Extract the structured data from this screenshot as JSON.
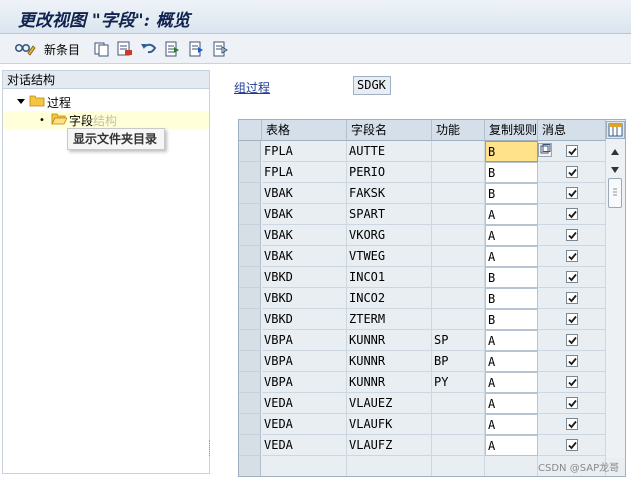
{
  "window": {
    "title": "更改视图 \"字段\": 概览"
  },
  "toolbar": {
    "new_entries_label": "新条目",
    "icons": [
      "display-change-icon",
      "copy-icon",
      "delete-icon",
      "undo-icon",
      "select-all-icon",
      "select-block-icon",
      "deselect-all-icon"
    ]
  },
  "tree": {
    "header": "对话结构",
    "items": [
      {
        "label": "过程",
        "icon": "folder-icon",
        "expanded": true
      },
      {
        "label": "字段",
        "icon": "folder-open-icon",
        "selected": true,
        "shadow_text": "结构"
      }
    ],
    "tooltip": "显示文件夹目录"
  },
  "group": {
    "label": "组过程",
    "value": "SDGK"
  },
  "table": {
    "columns": [
      "表格",
      "字段名",
      "功能",
      "复制规则",
      "消息"
    ],
    "rows": [
      {
        "table": "FPLA",
        "field": "AUTTE",
        "func": "",
        "rule": "B",
        "msg": true
      },
      {
        "table": "FPLA",
        "field": "PERIO",
        "func": "",
        "rule": "B",
        "msg": true
      },
      {
        "table": "VBAK",
        "field": "FAKSK",
        "func": "",
        "rule": "B",
        "msg": true
      },
      {
        "table": "VBAK",
        "field": "SPART",
        "func": "",
        "rule": "A",
        "msg": true
      },
      {
        "table": "VBAK",
        "field": "VKORG",
        "func": "",
        "rule": "A",
        "msg": true
      },
      {
        "table": "VBAK",
        "field": "VTWEG",
        "func": "",
        "rule": "A",
        "msg": true
      },
      {
        "table": "VBKD",
        "field": "INCO1",
        "func": "",
        "rule": "B",
        "msg": true
      },
      {
        "table": "VBKD",
        "field": "INCO2",
        "func": "",
        "rule": "B",
        "msg": true
      },
      {
        "table": "VBKD",
        "field": "ZTERM",
        "func": "",
        "rule": "B",
        "msg": true
      },
      {
        "table": "VBPA",
        "field": "KUNNR",
        "func": "SP",
        "rule": "A",
        "msg": true
      },
      {
        "table": "VBPA",
        "field": "KUNNR",
        "func": "BP",
        "rule": "A",
        "msg": true
      },
      {
        "table": "VBPA",
        "field": "KUNNR",
        "func": "PY",
        "rule": "A",
        "msg": true
      },
      {
        "table": "VEDA",
        "field": "VLAUEZ",
        "func": "",
        "rule": "A",
        "msg": true
      },
      {
        "table": "VEDA",
        "field": "VLAUFK",
        "func": "",
        "rule": "A",
        "msg": true
      },
      {
        "table": "VEDA",
        "field": "VLAUFZ",
        "func": "",
        "rule": "A",
        "msg": true
      },
      {
        "table": "",
        "field": "",
        "func": "",
        "rule": "",
        "msg": null
      }
    ]
  },
  "watermark": "CSDN @SAP龙哥",
  "colors": {
    "accent": "#1f3a93",
    "active_cell": "#ffe28a",
    "header_bg": "#d5dfe9"
  }
}
